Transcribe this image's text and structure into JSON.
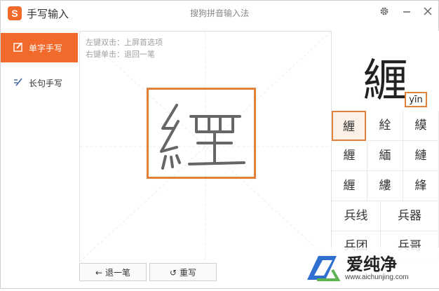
{
  "title_bar": {
    "logo_letter": "S",
    "app_title": "手写输入",
    "center_title": "搜狗拼音输入法",
    "settings_icon": "gear-icon",
    "minimize_icon": "minimize-icon",
    "close_icon": "close-icon"
  },
  "sidebar": {
    "items": [
      {
        "label": "单字手写",
        "icon": "pencil-icon",
        "active": true
      },
      {
        "label": "长句手写",
        "icon": "pen-lines-icon",
        "active": false
      }
    ]
  },
  "canvas": {
    "hint_line1": "左键双击：上屏首选项",
    "hint_line2": "右键单击：退回一笔",
    "handwritten_char": "緾"
  },
  "buttons": {
    "undo_label": "退一笔",
    "rewrite_label": "重写"
  },
  "candidates": {
    "preview_char": "緾",
    "pinyin": "yīn",
    "single_rows": [
      [
        "緾",
        "絟",
        "縸"
      ],
      [
        "緾",
        "緬",
        "縺"
      ],
      [
        "緾",
        "縷",
        "綘"
      ]
    ],
    "phrase_rows": [
      [
        "兵线",
        "兵器"
      ],
      [
        "兵团",
        "兵哥"
      ]
    ]
  },
  "watermark": {
    "brand": "爱纯净",
    "url": "www.aichunjing.com"
  },
  "colors": {
    "accent": "#f26a2b",
    "highlight_border": "#e0823a"
  }
}
